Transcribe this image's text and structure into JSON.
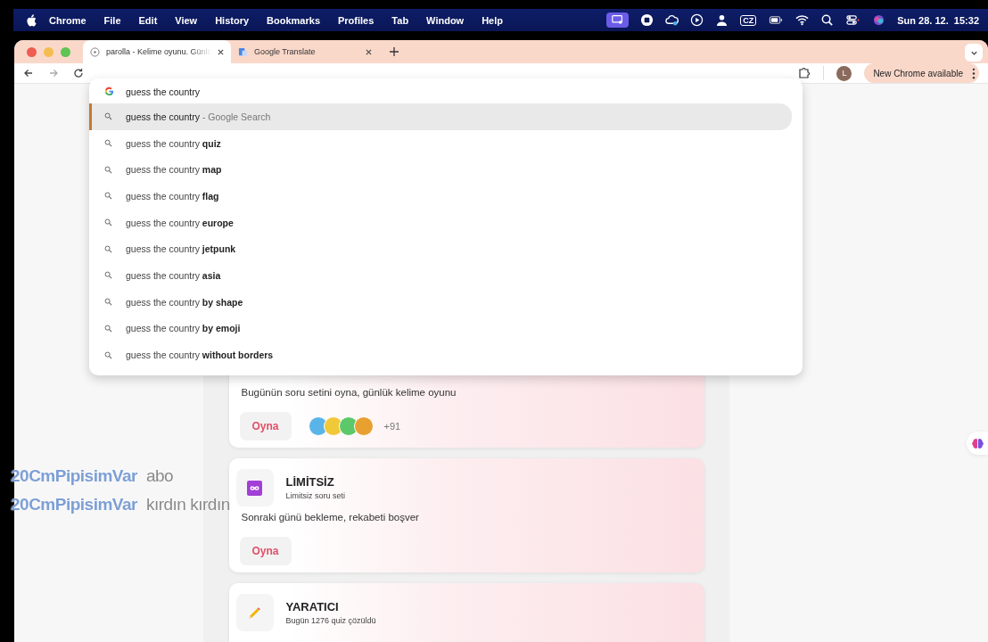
{
  "menubar": {
    "app": "Chrome",
    "menus": [
      "File",
      "Edit",
      "View",
      "History",
      "Bookmarks",
      "Profiles",
      "Tab",
      "Window",
      "Help"
    ],
    "keyboard": "CZ",
    "clock": "Sun 28. 12.  15:32"
  },
  "tabs": [
    {
      "title": "parolla - Kelime oyunu. Günlü",
      "selected": true
    },
    {
      "title": "Google Translate",
      "selected": false
    }
  ],
  "toolbar": {
    "profile_initial": "L",
    "update_button": "New Chrome available"
  },
  "omnibox": {
    "value": "guess the country"
  },
  "suggestions": [
    {
      "text": "guess the country",
      "hint": "- Google Search",
      "selected": true
    },
    {
      "text": "guess the country **quiz**",
      "selected": false
    },
    {
      "text": "guess the country **map**",
      "selected": false
    },
    {
      "text": "guess the country **flag**",
      "selected": false
    },
    {
      "text": "guess the country **europe**",
      "selected": false
    },
    {
      "text": "guess the country **jetpunk**",
      "selected": false
    },
    {
      "text": "guess the country **asia**",
      "selected": false
    },
    {
      "text": "guess the country **by shape**",
      "selected": false
    },
    {
      "text": "guess the country **by emoji**",
      "selected": false
    },
    {
      "text": "guess the country **without borders**",
      "selected": false
    }
  ],
  "cards": [
    {
      "kind": "daily",
      "description": "Bugünün soru setini oyna, günlük kelime oyunu",
      "button": "Oyna",
      "players_more": "+91"
    },
    {
      "kind": "unlimited",
      "title": "LİMİTSİZ",
      "subtitle": "Limitsiz soru seti",
      "description": "Sonraki günü bekleme, rekabeti boşver",
      "button": "Oyna"
    },
    {
      "kind": "creative",
      "title": "YARATICI",
      "subtitle": "Bugün 1276 quiz çözüldü"
    }
  ],
  "chat": [
    {
      "user": "20CmPipisimVar",
      "message": "abo"
    },
    {
      "user": "20CmPipisimVar",
      "message": "kırdın kırdın"
    }
  ]
}
